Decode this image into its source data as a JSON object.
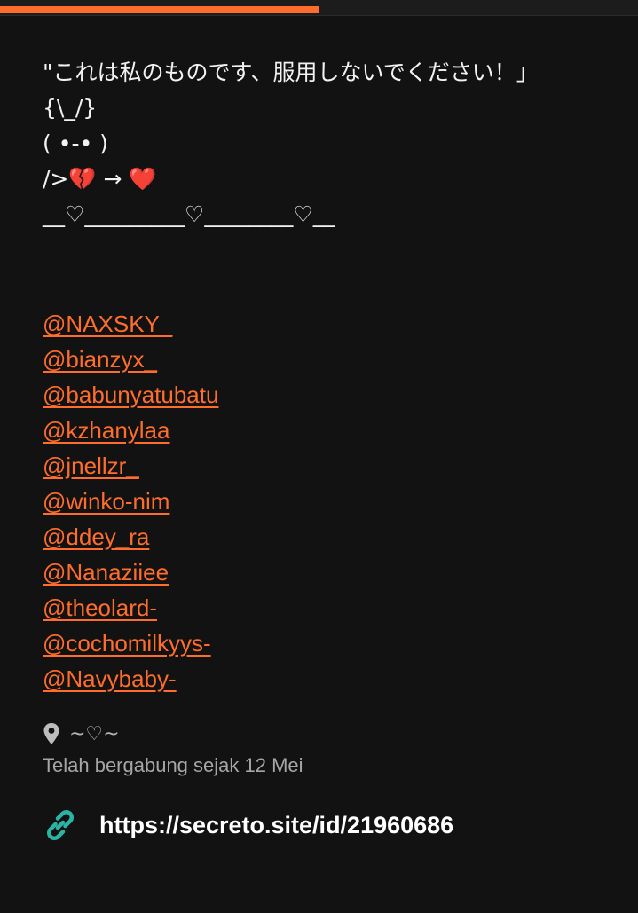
{
  "progress": {
    "fraction": 0.5,
    "color": "#ff6d2d"
  },
  "bio": {
    "line1": "\"これは私のものです、服用しないでください！」",
    "line2": "{\\_/}",
    "line3": "( •-• )",
    "line4_prefix": "/>",
    "line4_broken_heart": "💔",
    "line4_arrow": " → ",
    "line4_heart": "❤️",
    "line5": "__♡_________♡________♡__"
  },
  "mentions": [
    "@NAXSKY_",
    "@bianzyx_",
    "@babunyatubatu",
    "@kzhanylaa",
    "@jnellzr_",
    "@winko-nim",
    "@ddey_ra",
    "@Nanaziiee",
    "@theolard-",
    "@cochomilkyys-",
    "@Navybaby-"
  ],
  "location": {
    "icon": "map-pin-icon",
    "text": "~♡~"
  },
  "joined": "Telah bergabung sejak 12 Mei",
  "link": {
    "icon": "link-icon",
    "url": "https://secreto.site/id/21960686",
    "icon_color": "#2bb3a3"
  },
  "colors": {
    "accent": "#ff6d2d",
    "background": "#121212"
  }
}
